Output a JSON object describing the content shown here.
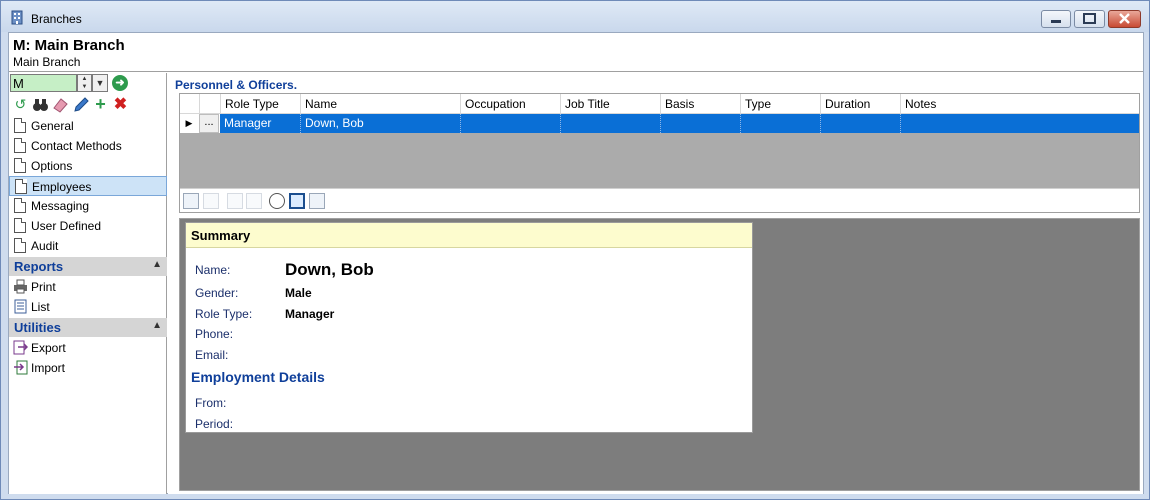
{
  "window": {
    "title": "Branches"
  },
  "header": {
    "title": "M: Main Branch",
    "subtitle": "Main Branch"
  },
  "sidebar": {
    "code_value": "M",
    "nav": [
      "General",
      "Contact Methods",
      "Options",
      "Employees",
      "Messaging",
      "User Defined",
      "Audit"
    ],
    "selected_nav": "Employees",
    "sections": [
      {
        "title": "Reports",
        "items": [
          "Print",
          "List"
        ]
      },
      {
        "title": "Utilities",
        "items": [
          "Export",
          "Import"
        ]
      }
    ]
  },
  "main": {
    "caption": "Personnel & Officers.",
    "grid": {
      "columns": [
        "Role Type",
        "Name",
        "Occupation",
        "Job Title",
        "Basis",
        "Type",
        "Duration",
        "Notes"
      ],
      "rows": [
        {
          "row_button": "...",
          "cells": [
            "Manager",
            "Down, Bob",
            "",
            "",
            "",
            "",
            "",
            ""
          ]
        }
      ]
    },
    "summary": {
      "heading": "Summary",
      "fields": [
        {
          "label": "Name:",
          "value": "Down, Bob"
        },
        {
          "label": "Gender:",
          "value": "Male"
        },
        {
          "label": "Role Type:",
          "value": "Manager"
        },
        {
          "label": "Phone:",
          "value": ""
        },
        {
          "label": "Email:",
          "value": ""
        }
      ],
      "employment_heading": "Employment Details",
      "employment_fields": [
        {
          "label": "From:",
          "value": ""
        },
        {
          "label": "Period:",
          "value": ""
        }
      ]
    }
  }
}
